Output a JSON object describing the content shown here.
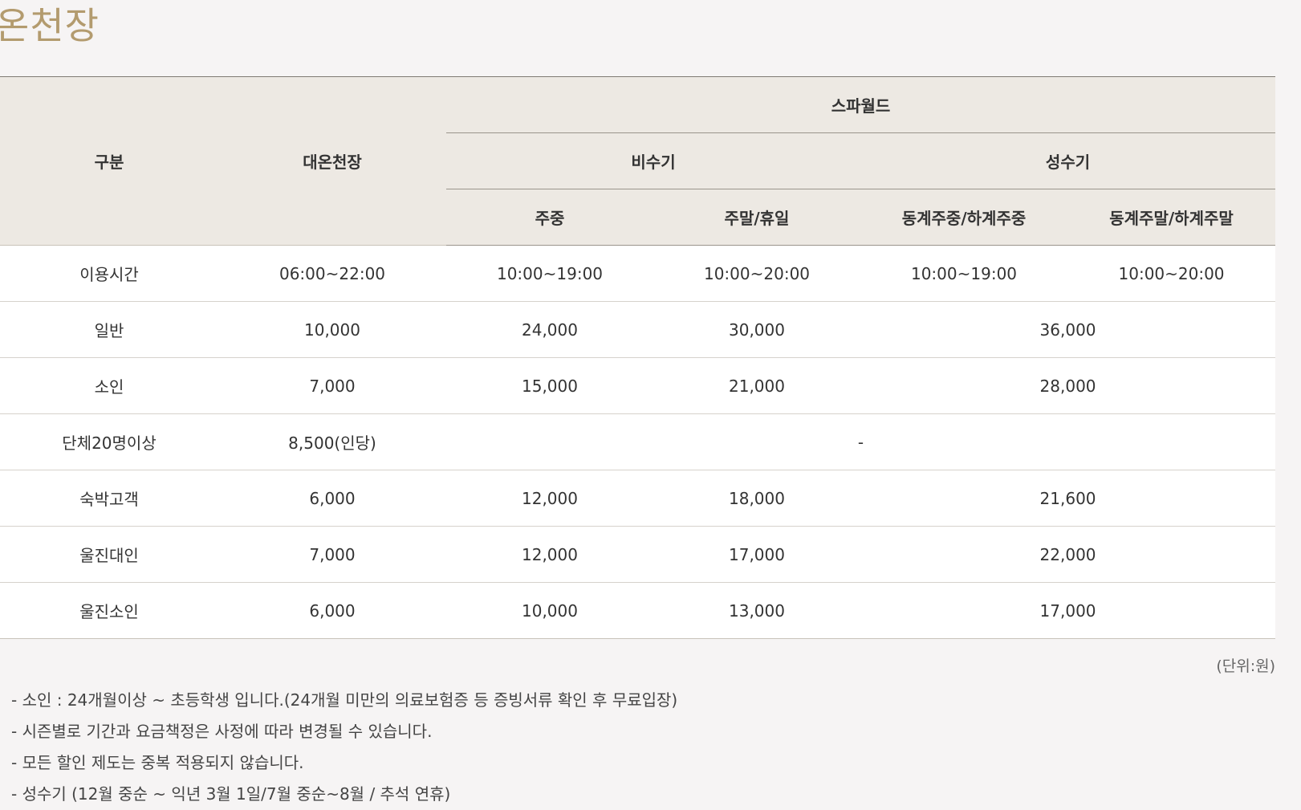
{
  "page": {
    "title": "온천장"
  },
  "table": {
    "head": {
      "category": "구분",
      "hot_spring": "대온천장",
      "spa_world": "스파월드",
      "off_season": "비수기",
      "peak_season": "성수기",
      "weekday": "주중",
      "weekend_holiday": "주말/휴일",
      "peak_weekday": "동계주중/하계주중",
      "peak_weekend": "동계주말/하계주말"
    },
    "rows": {
      "hours": {
        "label": "이용시간",
        "hot_spring": "06:00~22:00",
        "off_weekday": "10:00~19:00",
        "off_weekend": "10:00~20:00",
        "peak_weekday": "10:00~19:00",
        "peak_weekend": "10:00~20:00"
      },
      "adult": {
        "label": "일반",
        "hot_spring": "10,000",
        "off_weekday": "24,000",
        "off_weekend": "30,000",
        "peak": "36,000"
      },
      "child": {
        "label": "소인",
        "hot_spring": "7,000",
        "off_weekday": "15,000",
        "off_weekend": "21,000",
        "peak": "28,000"
      },
      "group": {
        "label": "단체20명이상",
        "hot_spring": "8,500(인당)",
        "spa_world": "-"
      },
      "guest": {
        "label": "숙박고객",
        "hot_spring": "6,000",
        "off_weekday": "12,000",
        "off_weekend": "18,000",
        "peak": "21,600"
      },
      "uljin_adult": {
        "label": "울진대인",
        "hot_spring": "7,000",
        "off_weekday": "12,000",
        "off_weekend": "17,000",
        "peak": "22,000"
      },
      "uljin_child": {
        "label": "울진소인",
        "hot_spring": "6,000",
        "off_weekday": "10,000",
        "off_weekend": "13,000",
        "peak": "17,000"
      }
    }
  },
  "unit_note": "(단위:원)",
  "notes": [
    "- 소인 : 24개월이상 ~ 초등학생 입니다.(24개월 미만의 의료보험증 등 증빙서류 확인 후 무료입장)",
    "- 시즌별로 기간과 요금책정은 사정에 따라 변경될 수 있습니다.",
    "- 모든 할인 제도는 중복 적용되지 않습니다.",
    "- 성수기 (12월 중순 ~ 익년 3월 1일/7월 중순~8월 / 추석 연휴)"
  ]
}
